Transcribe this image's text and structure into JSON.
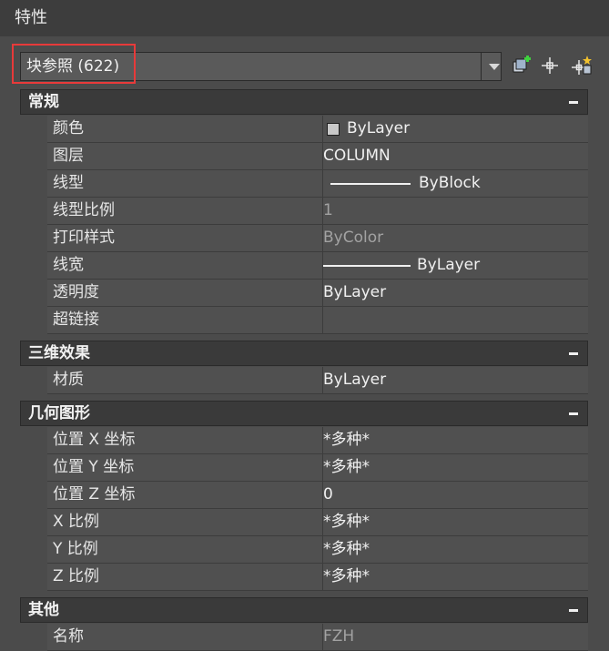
{
  "window": {
    "title": "特性"
  },
  "selector": {
    "value": "块参照 (622)"
  },
  "toolbar": {
    "buttons": [
      {
        "name": "quick-select-icon"
      },
      {
        "name": "select-objects-icon"
      },
      {
        "name": "toggle-pickadd-icon"
      }
    ]
  },
  "sections": {
    "general": {
      "title": "常规",
      "rows": [
        {
          "name": "颜色",
          "value": "ByLayer"
        },
        {
          "name": "图层",
          "value": "COLUMN"
        },
        {
          "name": "线型",
          "value": "ByBlock"
        },
        {
          "name": "线型比例",
          "value": "1"
        },
        {
          "name": "打印样式",
          "value": "ByColor"
        },
        {
          "name": "线宽",
          "value": "ByLayer"
        },
        {
          "name": "透明度",
          "value": "ByLayer"
        },
        {
          "name": "超链接",
          "value": ""
        }
      ]
    },
    "threed": {
      "title": "三维效果",
      "rows": [
        {
          "name": "材质",
          "value": "ByLayer"
        }
      ]
    },
    "geometry": {
      "title": "几何图形",
      "rows": [
        {
          "name": "位置 X 坐标",
          "value": "*多种*"
        },
        {
          "name": "位置 Y 坐标",
          "value": "*多种*"
        },
        {
          "name": "位置 Z 坐标",
          "value": "0"
        },
        {
          "name": "X 比例",
          "value": "*多种*"
        },
        {
          "name": "Y 比例",
          "value": "*多种*"
        },
        {
          "name": "Z 比例",
          "value": "*多种*"
        }
      ]
    },
    "misc": {
      "title": "其他",
      "rows": [
        {
          "name": "名称",
          "value": "FZH"
        }
      ]
    }
  },
  "colors": {
    "accent_highlight": "#e83a3a",
    "swatch": "#c8c8c8"
  }
}
